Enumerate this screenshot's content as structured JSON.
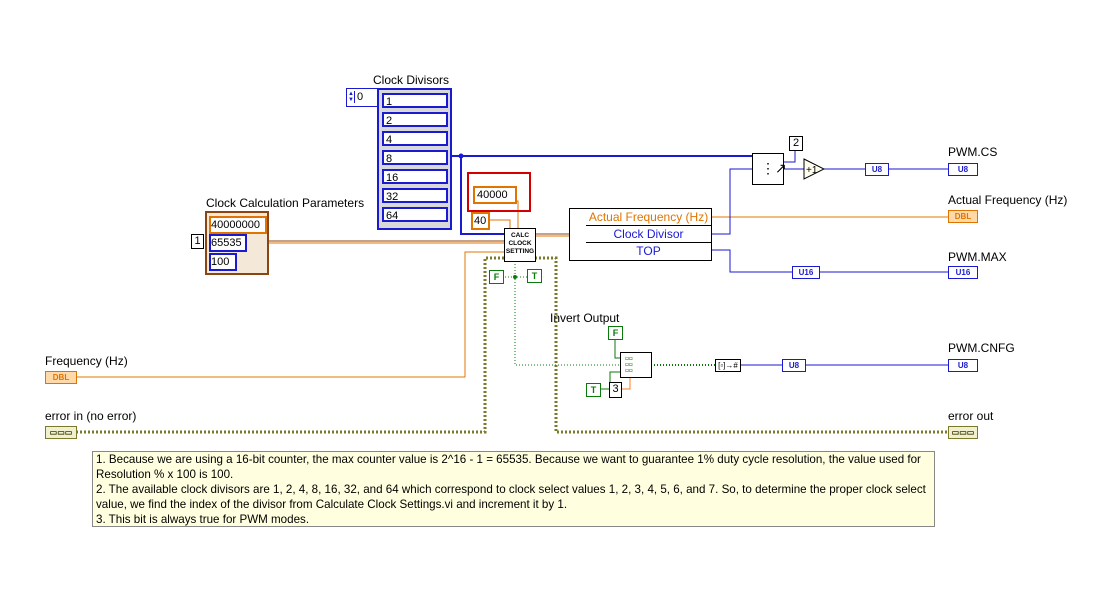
{
  "clock_divisors": {
    "label": "Clock Divisors",
    "index": "0",
    "items": [
      "1",
      "2",
      "4",
      "8",
      "16",
      "32",
      "64"
    ]
  },
  "clock_params": {
    "label": "Clock Calculation Parameters",
    "index": "1",
    "values": [
      "40000000",
      "65535",
      "100"
    ]
  },
  "subvi": {
    "line1": "CALC",
    "line2": "CLOCK",
    "line3": "SETTING"
  },
  "subvi_inputs": {
    "const_a": "40000",
    "const_b": "40"
  },
  "output_cluster": {
    "items": [
      "Actual Frequency (Hz)",
      "Clock Divisor",
      "TOP"
    ]
  },
  "index_const": "2",
  "bit_const": "3",
  "terminals": {
    "pwm_cs": "PWM.CS",
    "actual_freq": "Actual Frequency (Hz)",
    "pwm_max": "PWM.MAX",
    "pwm_cnfg": "PWM.CNFG",
    "frequency": "Frequency (Hz)",
    "error_in": "error in (no error)",
    "error_out": "error out",
    "invert_output": "Invert Output"
  },
  "type_tags": {
    "u8": "U8",
    "u16": "U16",
    "dbl": "DBL"
  },
  "bool_consts": {
    "false": "F",
    "true": "T"
  },
  "comment": {
    "line1": "1. Because we are using a 16-bit counter, the max counter value is 2^16 - 1 = 65535. Because we want to guarantee 1% duty cycle  resolution, the value used for Resolution % x 100 is 100.",
    "line2": "2. The available clock divisors are 1, 2, 4, 8, 16, 32, and 64 which correspond to clock select values 1, 2, 3, 4, 5, 6, and 7. So, to determine the proper clock select value, we find the index of the divisor from Calculate Clock Settings.vi and increment it by 1.",
    "line3": "3. This bit is always true for PWM modes."
  },
  "colors": {
    "int_wire": "#1a1ad0",
    "dbl_wire": "#e07400",
    "bool_wire": "#0a7a0a",
    "cluster_wire": "#8b4513",
    "error_wire": "#7a7a2a",
    "highlight": "#d40000"
  }
}
